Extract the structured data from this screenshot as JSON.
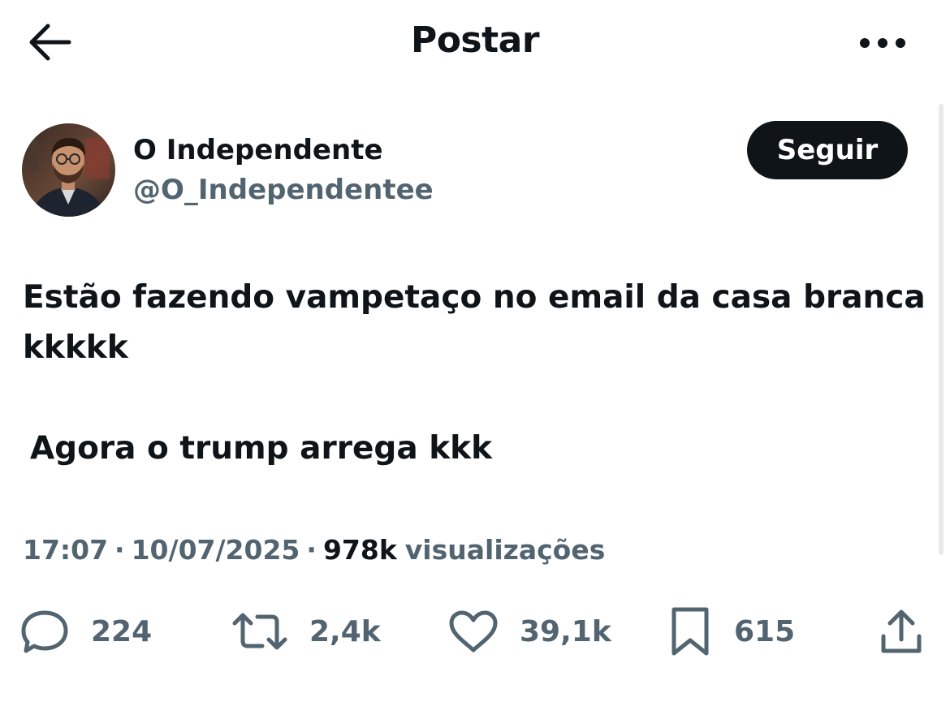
{
  "header": {
    "title": "Postar",
    "back_icon": "arrow-left-icon",
    "more_icon": "more-horizontal-icon"
  },
  "author": {
    "display_name": "O Independente",
    "handle": "@O_Independentee",
    "follow_label": "Seguir",
    "avatar_icon": "avatar-photo"
  },
  "post": {
    "line1": "Estão fazendo vampetaço no email da casa branca",
    "line2": "kkkkk",
    "line3": "Agora o trump arrega kkk"
  },
  "meta": {
    "time": "17:07",
    "date": "10/07/2025",
    "views_count": "978k",
    "views_label": "visualizações"
  },
  "actions": {
    "replies": "224",
    "reposts": "2,4k",
    "likes": "39,1k",
    "bookmarks": "615"
  },
  "colors": {
    "text_primary": "#0f1419",
    "text_secondary": "#536471",
    "follow_bg": "#0f1419",
    "follow_text": "#ffffff"
  }
}
